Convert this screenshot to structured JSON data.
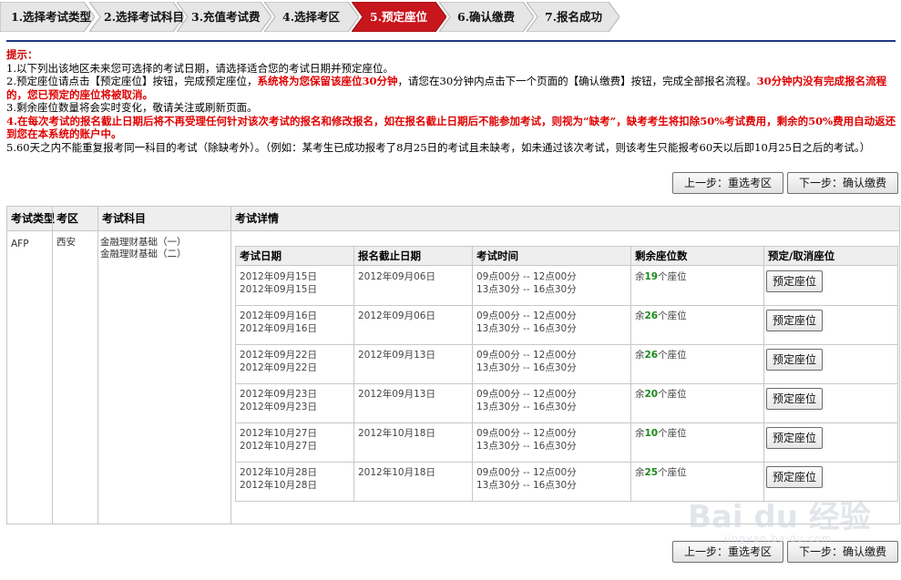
{
  "steps": [
    {
      "label": "1.选择考试类型",
      "active": false
    },
    {
      "label": "2.选择考试科目",
      "active": false
    },
    {
      "label": "3.充值考试费",
      "active": false
    },
    {
      "label": "4.选择考区",
      "active": false
    },
    {
      "label": "5.预定座位",
      "active": true
    },
    {
      "label": "6.确认缴费",
      "active": false
    },
    {
      "label": "7.报名成功",
      "active": false
    }
  ],
  "colors": {
    "step_active": "#c8161d",
    "step_inactive": "#e6e6e6",
    "accent_line": "#1f3a82",
    "warning": "#e00000",
    "seat_count": "#1a8a1a"
  },
  "tips": {
    "title": "提示：",
    "line1": "1.以下列出该地区未来您可选择的考试日期，请选择适合您的考试日期并预定座位。",
    "line2_a": "2.预定座位请点击【预定座位】按钮，完成预定座位，",
    "line2_b": "系统将为您保留该座位30分钟",
    "line2_c": "，请您在30分钟内点击下一个页面的【确认缴费】按钮，完成全部报名流程。",
    "line2_d": "30分钟内没有完成报名流程的，您已预定的座位将被取消。",
    "line3": "3.剩余座位数量将会实时变化，敬请关注或刷新页面。",
    "line4": "4.在每次考试的报名截止日期后将不再受理任何针对该次考试的报名和修改报名，如在报名截止日期后不能参加考试，则视为“缺考”，缺考考生将扣除50%考试费用，剩余的50%费用自动返还到您在本系统的账户中。",
    "line5": "5.60天之内不能重复报考同一科目的考试（除缺考外）。（例如：某考生已成功报考了8月25日的考试且未缺考，如未通过该次考试，则该考生只能报考60天以后即10月25日之后的考试。）"
  },
  "nav": {
    "prev": "上一步：重选考区",
    "next": "下一步：确认缴费"
  },
  "table": {
    "headers": {
      "type": "考试类型",
      "region": "考区",
      "subject": "考试科目",
      "detail": "考试详情"
    },
    "type": "AFP",
    "region": "西安",
    "subjects": [
      "金融理财基础（一）",
      "金融理财基础（二）"
    ],
    "inner_headers": {
      "date": "考试日期",
      "deadline": "报名截止日期",
      "time": "考试时间",
      "seats": "剩余座位数",
      "action": "预定/取消座位"
    },
    "rows": [
      {
        "date1": "2012年09月15日",
        "date2": "2012年09月15日",
        "deadline": "2012年09月06日",
        "time1": "09点00分 -- 12点00分",
        "time2": "13点30分 -- 16点30分",
        "seat_prefix": "余",
        "seat_count": "19",
        "seat_suffix": "个座位",
        "button": "预定座位"
      },
      {
        "date1": "2012年09月16日",
        "date2": "2012年09月16日",
        "deadline": "2012年09月06日",
        "time1": "09点00分 -- 12点00分",
        "time2": "13点30分 -- 16点30分",
        "seat_prefix": "余",
        "seat_count": "26",
        "seat_suffix": "个座位",
        "button": "预定座位"
      },
      {
        "date1": "2012年09月22日",
        "date2": "2012年09月22日",
        "deadline": "2012年09月13日",
        "time1": "09点00分 -- 12点00分",
        "time2": "13点30分 -- 16点30分",
        "seat_prefix": "余",
        "seat_count": "26",
        "seat_suffix": "个座位",
        "button": "预定座位"
      },
      {
        "date1": "2012年09月23日",
        "date2": "2012年09月23日",
        "deadline": "2012年09月13日",
        "time1": "09点00分 -- 12点00分",
        "time2": "13点30分 -- 16点30分",
        "seat_prefix": "余",
        "seat_count": "20",
        "seat_suffix": "个座位",
        "button": "预定座位"
      },
      {
        "date1": "2012年10月27日",
        "date2": "2012年10月27日",
        "deadline": "2012年10月18日",
        "time1": "09点00分 -- 12点00分",
        "time2": "13点30分 -- 16点30分",
        "seat_prefix": "余",
        "seat_count": "10",
        "seat_suffix": "个座位",
        "button": "预定座位"
      },
      {
        "date1": "2012年10月28日",
        "date2": "2012年10月28日",
        "deadline": "2012年10月18日",
        "time1": "09点00分 -- 12点00分",
        "time2": "13点30分 -- 16点30分",
        "seat_prefix": "余",
        "seat_count": "25",
        "seat_suffix": "个座位",
        "button": "预定座位"
      }
    ]
  },
  "watermark": {
    "text": "Bai du 经验",
    "sub": "jingyan.baidu.com"
  }
}
